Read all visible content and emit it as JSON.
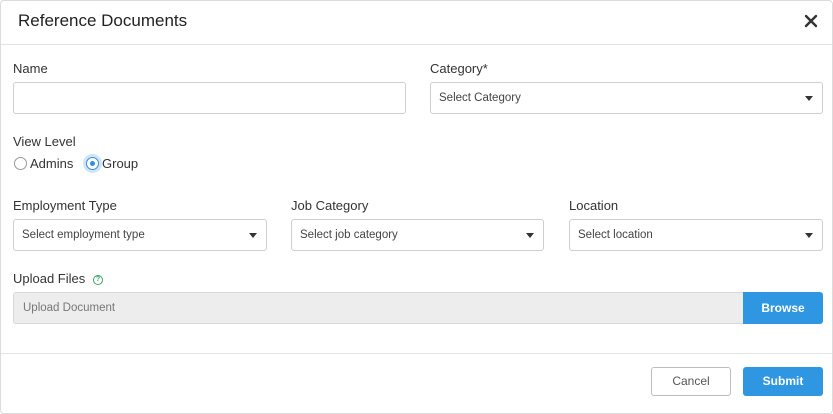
{
  "modal": {
    "title": "Reference Documents"
  },
  "form": {
    "name_label": "Name",
    "name_value": "",
    "category_label": "Category*",
    "category_selected": "Select Category",
    "view_level_label": "View Level",
    "view_level_options": [
      {
        "label": "Admins",
        "checked": false
      },
      {
        "label": "Group",
        "checked": true
      }
    ],
    "employment_type_label": "Employment Type",
    "employment_type_selected": "Select employment type",
    "job_category_label": "Job Category",
    "job_category_selected": "Select job category",
    "location_label": "Location",
    "location_selected": "Select location",
    "upload_label": "Upload Files",
    "upload_placeholder": "Upload Document",
    "browse_label": "Browse"
  },
  "footer": {
    "cancel_label": "Cancel",
    "submit_label": "Submit"
  },
  "colors": {
    "accent": "#2f97e1",
    "help_icon": "#3aa56a"
  },
  "icons": {
    "close": "close-icon",
    "help": "question-circle-icon",
    "dropdown": "caret-down-icon"
  }
}
